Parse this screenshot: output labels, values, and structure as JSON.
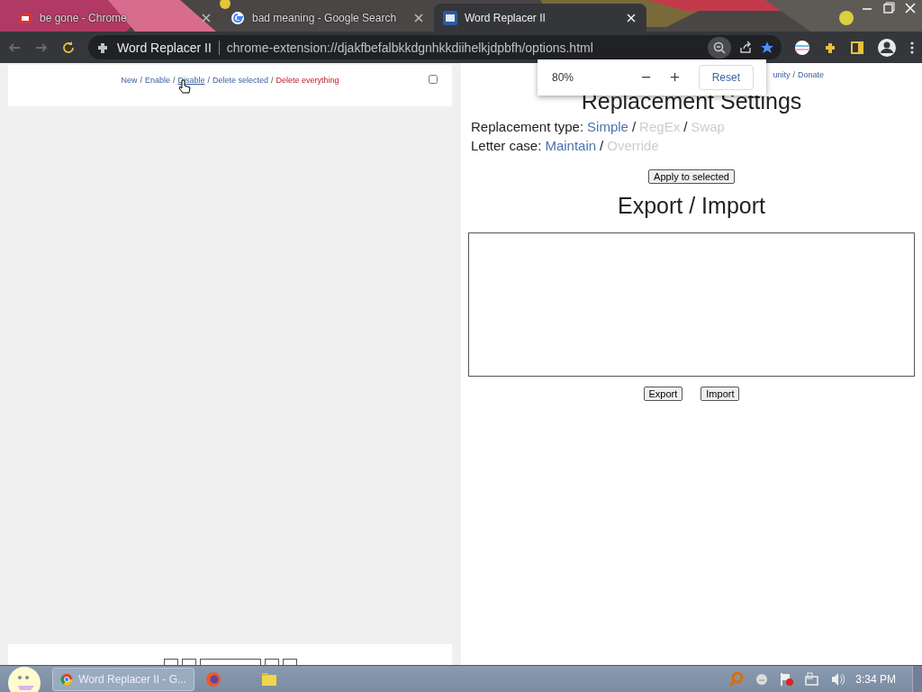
{
  "tabs": [
    {
      "title": "be gone - Chrome",
      "selected": false
    },
    {
      "title": "bad meaning - Google Search",
      "selected": false
    },
    {
      "title": "Word Replacer II",
      "selected": true
    }
  ],
  "toolbar": {
    "site_label": "Word Replacer II",
    "url": "chrome-extension://djakfbefalbkkdgnhkkdiihelkjdpbfh/options.html"
  },
  "zoom_popup": {
    "value": "80%",
    "minus": "−",
    "plus": "+",
    "reset": "Reset"
  },
  "left_panel": {
    "separator": "/",
    "actions": [
      {
        "label": "New",
        "kind": "normal",
        "hovered": false
      },
      {
        "label": "Enable",
        "kind": "normal",
        "hovered": false
      },
      {
        "label": "Disable",
        "kind": "normal",
        "hovered": true
      },
      {
        "label": "Delete selected",
        "kind": "normal",
        "hovered": false
      },
      {
        "label": "Delete everything",
        "kind": "danger",
        "hovered": false
      }
    ],
    "select_all_checked": false
  },
  "right_panel": {
    "top_links": [
      "unity",
      "Donate"
    ],
    "separator": "/",
    "heading": "Replacement Settings",
    "settings": [
      {
        "label": "Replacement type:",
        "separator": "/",
        "options": [
          {
            "label": "Simple",
            "selected": true
          },
          {
            "label": "RegEx",
            "selected": false
          },
          {
            "label": "Swap",
            "selected": false
          }
        ]
      },
      {
        "label": "Letter case:",
        "separator": "/",
        "options": [
          {
            "label": "Maintain",
            "selected": true
          },
          {
            "label": "Override",
            "selected": false
          }
        ]
      }
    ],
    "apply_button": "Apply to selected",
    "export_heading": "Export / Import",
    "buttons": [
      "Export",
      "Import"
    ]
  },
  "taskbar": {
    "task": "Word Replacer II - G...",
    "clock": "3:34 PM"
  }
}
